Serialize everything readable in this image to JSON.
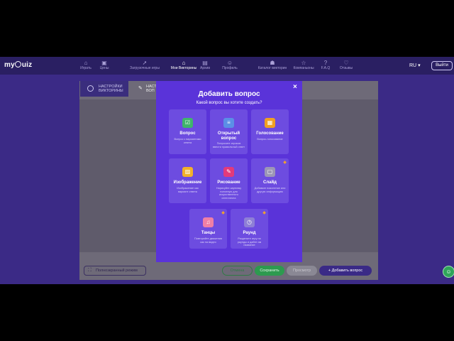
{
  "nav": {
    "logo": "myQuiz",
    "items": [
      {
        "icon": "gamepad-icon",
        "glyph": "⌂",
        "label": "Играть"
      },
      {
        "icon": "tag-icon",
        "glyph": "▣",
        "label": "Цены"
      },
      {
        "icon": "rocket-icon",
        "glyph": "➚",
        "label": "Загрузочные игры"
      },
      {
        "icon": "home-icon",
        "glyph": "⌂",
        "label": "Мои Викторины"
      },
      {
        "icon": "archive-icon",
        "glyph": "▤",
        "label": "Архив"
      },
      {
        "icon": "user-icon",
        "glyph": "☺",
        "label": "Профиль"
      },
      {
        "icon": "marketplace-icon",
        "glyph": "☗",
        "label": "Каталог викторин"
      },
      {
        "icon": "star-icon",
        "glyph": "☆",
        "label": "Компаньоны"
      },
      {
        "icon": "question-icon",
        "glyph": "?",
        "label": "F.A.Q"
      },
      {
        "icon": "heart-icon",
        "glyph": "♡",
        "label": "Отзывы"
      }
    ],
    "lang": "RU",
    "logout": "Выйти"
  },
  "editor": {
    "tab_settings": "НАСТРОЙКИ ВИКТОРИНЫ",
    "tab_questions": "НАСТ ВОП",
    "fullscreen": "Полноэкранный режим",
    "cancel": "Отмена",
    "save": "Сохранить",
    "preview": "Просмотр",
    "add_question": "+  Добавить вопрос"
  },
  "modal": {
    "title": "Добавить вопрос",
    "subtitle": "Какой вопрос вы хотите создать?",
    "close": "×",
    "cards": [
      {
        "title": "Вопрос",
        "desc": "Вопрос с вариантами ответа",
        "icon": "checkbox-icon",
        "glyph": "☑",
        "color": "#3fb56b",
        "premium": false
      },
      {
        "title": "Открытый вопрос",
        "desc": "Попросите игроков ввести правильный ответ",
        "icon": "text-input-icon",
        "glyph": "≡",
        "color": "#5b8fe6",
        "premium": false
      },
      {
        "title": "Голосование",
        "desc": "Вопрос-голосование",
        "icon": "poll-icon",
        "glyph": "▦",
        "color": "#f0a023",
        "premium": false
      },
      {
        "title": "Изображение",
        "desc": "Изображение как вариант ответа",
        "icon": "image-icon",
        "glyph": "▨",
        "color": "#f2b12a",
        "premium": false
      },
      {
        "title": "Рисование",
        "desc": "Нарисуйте картинку понятную для искусственного интеллекта",
        "icon": "brush-icon",
        "glyph": "✎",
        "color": "#e23a7b",
        "premium": false
      },
      {
        "title": "Слайд",
        "desc": "Добавьте пояснение или другую информацию",
        "icon": "slide-icon",
        "glyph": "▢",
        "color": "#9c96b6",
        "premium": true
      },
      {
        "title": "Танцы",
        "desc": "Повторяйте движения как на видео",
        "icon": "music-icon",
        "glyph": "♫",
        "color": "#ef7fa6",
        "premium": true
      },
      {
        "title": "Раунд",
        "desc": "Разделите игру на раунды и дайте им название",
        "icon": "clock-icon",
        "glyph": "◷",
        "color": "#8e7fd6",
        "premium": true
      }
    ]
  },
  "chat_icon": "☺"
}
